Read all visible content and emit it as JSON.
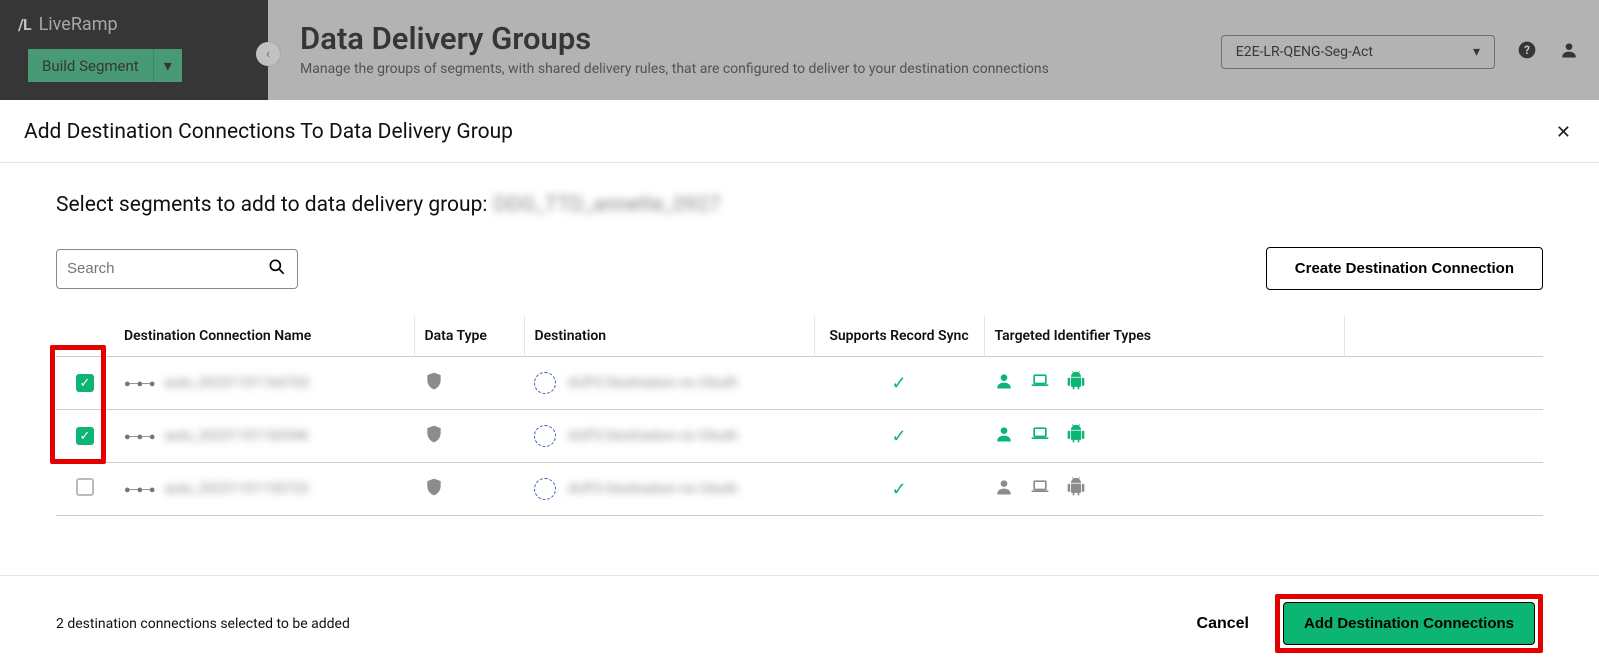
{
  "header": {
    "brand": "LiveRamp",
    "logo_mark": "/L",
    "build_segment_label": "Build Segment",
    "collapse_glyph": "‹",
    "page_title": "Data Delivery Groups",
    "page_subtitle": "Manage the groups of segments, with shared delivery rules, that are configured to deliver to your destination connections",
    "account_selector": "E2E-LR-QENG-Seg-Act"
  },
  "modal": {
    "title": "Add Destination Connections To Data Delivery Group",
    "close_glyph": "✕",
    "prompt": "Select segments to add to data delivery group:",
    "group_name": "DDG_TTD_annette_0927",
    "search_placeholder": "Search",
    "create_button": "Create Destination Connection",
    "columns": {
      "name": "Destination Connection Name",
      "data_type": "Data Type",
      "destination": "Destination",
      "sync": "Supports Record Sync",
      "target": "Targeted Identifier Types"
    },
    "rows": [
      {
        "checked": true,
        "name": "auto_20231101164703",
        "destination": "AUFS Destination no OAuth",
        "sync": true,
        "active_ids": true
      },
      {
        "checked": true,
        "name": "auto_20231101160546",
        "destination": "AUFS Destination no OAuth",
        "sync": true,
        "active_ids": true
      },
      {
        "checked": false,
        "name": "auto_20231101155725",
        "destination": "AUFS Destination no OAuth",
        "sync": true,
        "active_ids": false
      }
    ],
    "footer_status": "2 destination connections selected to be added",
    "cancel_label": "Cancel",
    "submit_label": "Add Destination Connections"
  }
}
